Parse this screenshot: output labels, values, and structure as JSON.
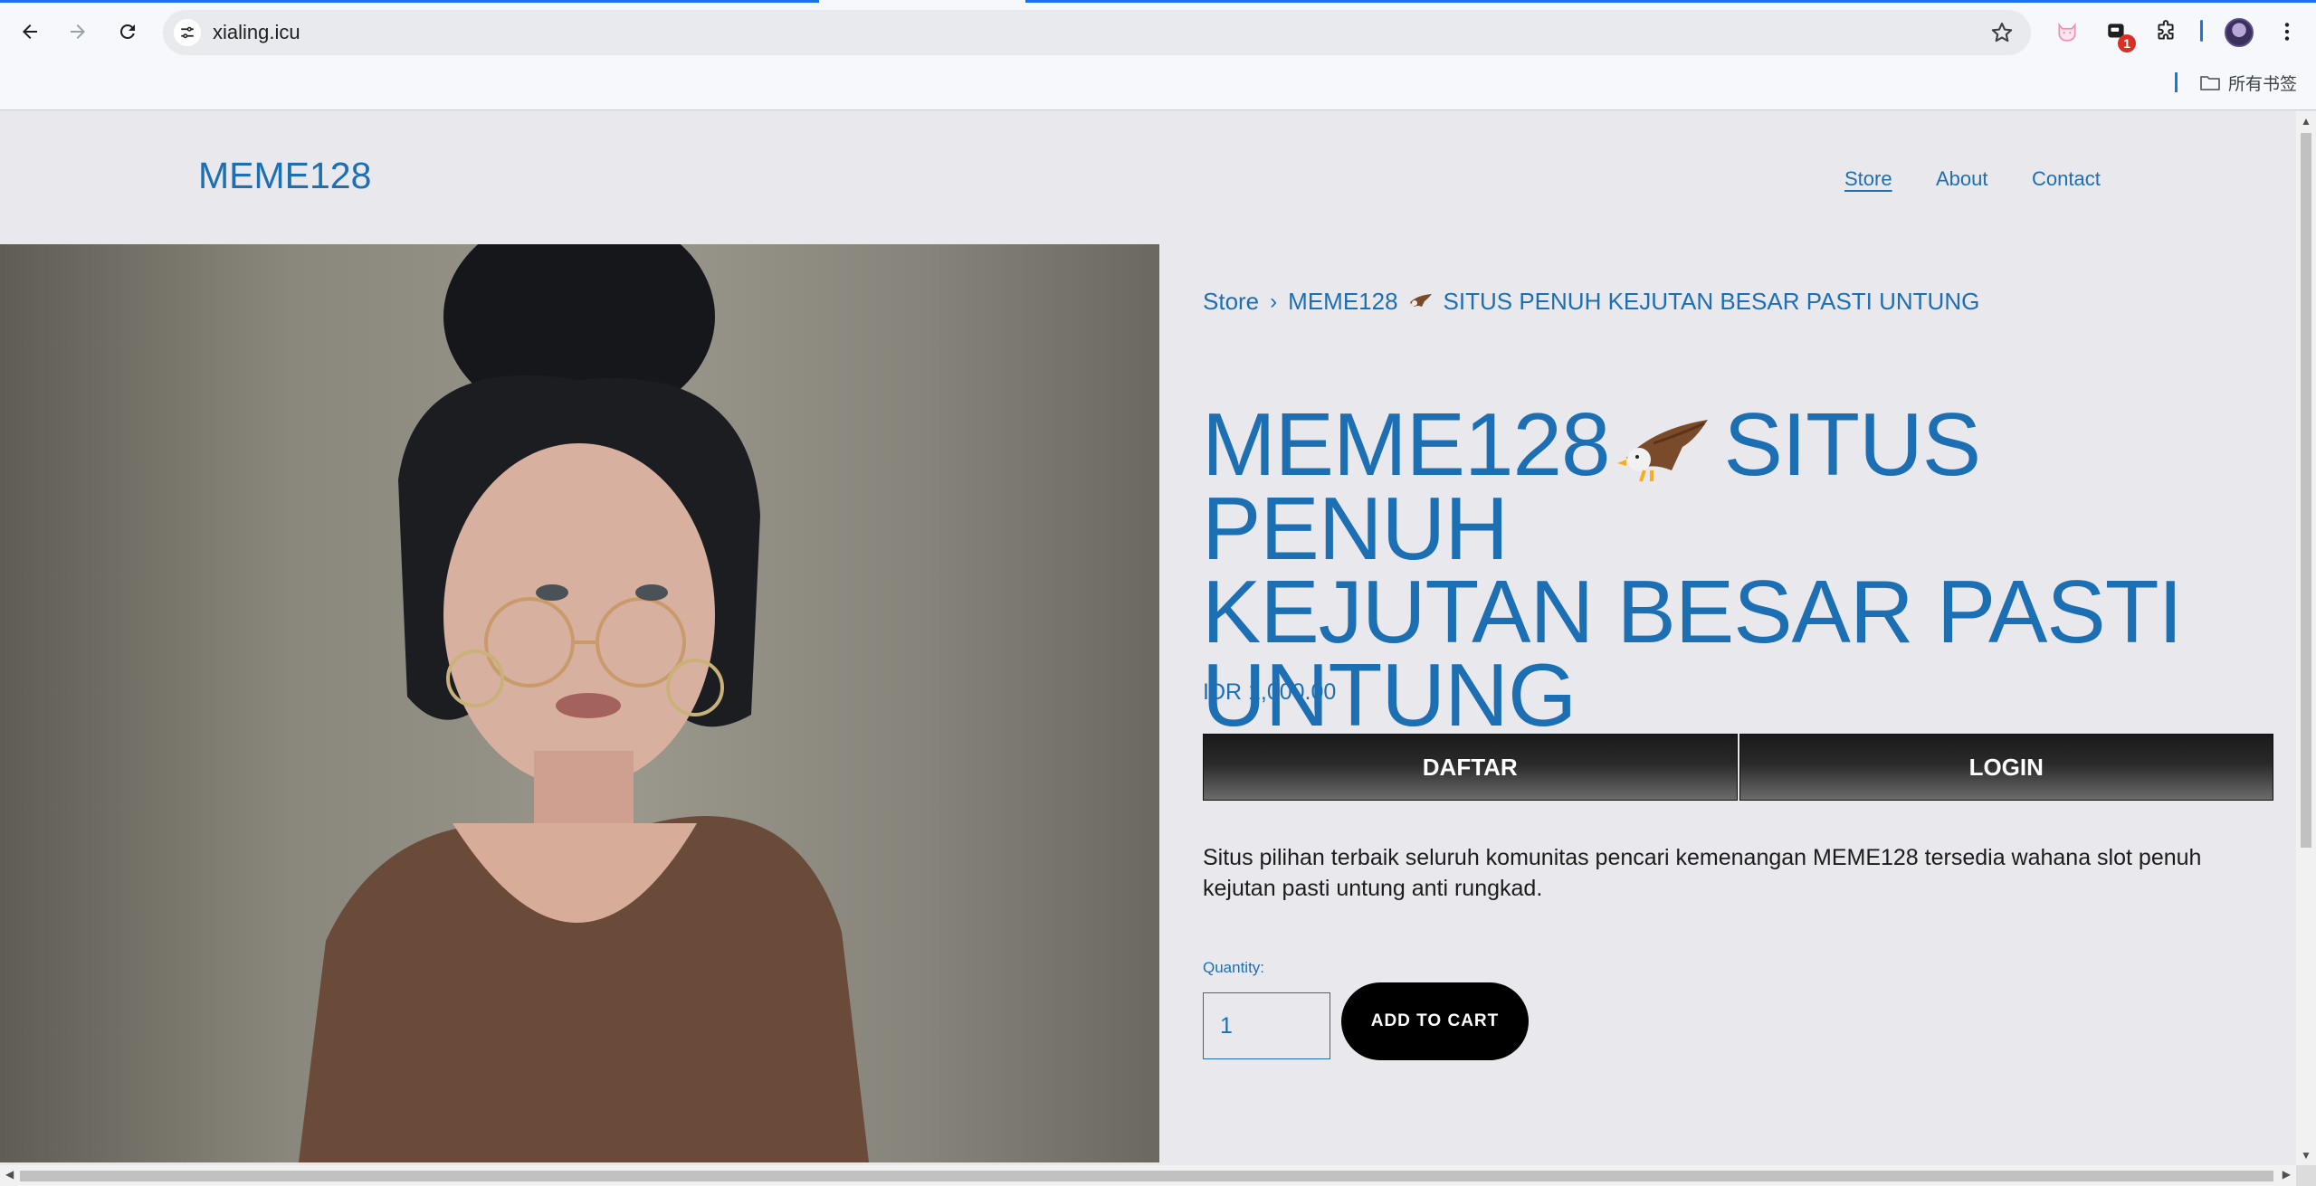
{
  "browser": {
    "url": "xialing.icu",
    "extension_badge": "1",
    "bookmarks_all_label": "所有书签"
  },
  "site": {
    "brand": "MEME128",
    "nav": [
      "Store",
      "About",
      "Contact"
    ],
    "active_nav": "Store"
  },
  "breadcrumb": {
    "root": "Store",
    "separator": "›",
    "current_prefix": "MEME128",
    "current_suffix": "SITUS PENUH KEJUTAN BESAR PASTI UNTUNG"
  },
  "product": {
    "title_line1_prefix": "MEME128",
    "title_line1_suffix": "SITUS PENUH",
    "title_line2": "KEJUTAN BESAR PASTI",
    "title_line3": "UNTUNG",
    "price": "IDR 1,000.00",
    "buttons": [
      "DAFTAR",
      "LOGIN"
    ],
    "description": "Situs pilihan terbaik seluruh komunitas pencari kemenangan MEME128 tersedia wahana slot penuh kejutan pasti untung anti rungkad.",
    "quantity_label": "Quantity:",
    "quantity_value": "1",
    "add_to_cart": "ADD TO CART"
  },
  "colors": {
    "link": "#1d6fb4",
    "page_bg": "#e9e8ec",
    "button_dark": "#1a1a1a"
  },
  "icons": [
    "back-icon",
    "forward-icon",
    "reload-icon",
    "site-info-icon",
    "bookmark-star-icon",
    "cat-extension-icon",
    "extension-badge-icon",
    "puzzle-icon",
    "menu-dots-icon",
    "folder-icon",
    "eagle-emoji-icon"
  ]
}
